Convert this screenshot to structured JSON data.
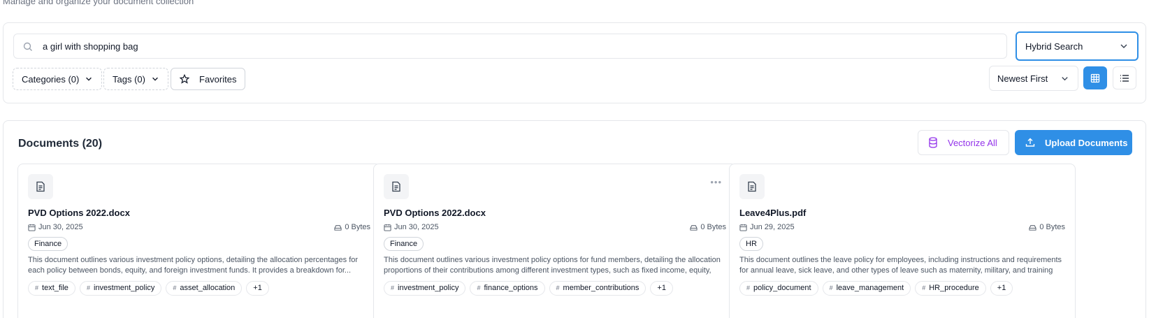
{
  "header": {
    "subtitle": "Manage and organize your document collection"
  },
  "search": {
    "query": "a girl with shopping bag",
    "mode": "Hybrid Search"
  },
  "filters": {
    "categories_label": "Categories (0)",
    "tags_label": "Tags (0)",
    "favorites_label": "Favorites",
    "sort_label": "Newest First"
  },
  "documents": {
    "title": "Documents (20)",
    "vectorize_label": "Vectorize All",
    "upload_label": "Upload Documents",
    "cards": [
      {
        "name": "PVD Options 2022.docx",
        "date": "Jun 30, 2025",
        "size": "0 Bytes",
        "category": "Finance",
        "description": "This document outlines various investment policy options, detailing the allocation percentages for each policy between bonds, equity, and foreign investment funds. It provides a breakdown for...",
        "tags": [
          "text_file",
          "investment_policy",
          "asset_allocation"
        ],
        "more": "+1"
      },
      {
        "name": "PVD Options 2022.docx",
        "date": "Jun 30, 2025",
        "size": "0 Bytes",
        "category": "Finance",
        "description": "This document outlines various investment policy options for fund members, detailing the allocation proportions of their contributions among different investment types, such as fixed income, equity, an...",
        "tags": [
          "investment_policy",
          "finance_options",
          "member_contributions"
        ],
        "more": "+1"
      },
      {
        "name": "Leave4Plus.pdf",
        "date": "Jun 29, 2025",
        "size": "0 Bytes",
        "category": "HR",
        "description": "This document outlines the leave policy for employees, including instructions and requirements for annual leave, sick leave, and other types of leave such as maternity, military, and training leave. It...",
        "tags": [
          "policy_document",
          "leave_management",
          "HR_procedure"
        ],
        "more": "+1"
      }
    ]
  },
  "colors": {
    "primary": "#2f8fe6",
    "vectorize": "#9333ea",
    "border": "#e5e7eb"
  }
}
